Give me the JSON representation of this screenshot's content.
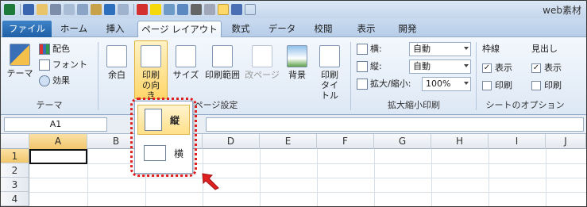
{
  "title_bar": {
    "title": "web素材"
  },
  "tabs": [
    "ファイル",
    "ホーム",
    "挿入",
    "ページ レイアウト",
    "数式",
    "データ",
    "校閲",
    "表示",
    "開発"
  ],
  "ribbon": {
    "theme": {
      "theme_label": "テーマ",
      "colors": "配色",
      "fonts": "フォント",
      "effects": "効果",
      "group": "テーマ"
    },
    "page_setup": {
      "margins": "余白",
      "orientation": "印刷の向き",
      "size": "サイズ",
      "print_area": "印刷範囲",
      "breaks": "改ページ",
      "background": "背景",
      "print_titles": "印刷タイトル",
      "group": "ページ設定"
    },
    "scale": {
      "width_label": "横:",
      "width_value": "自動",
      "height_label": "縦:",
      "height_value": "自動",
      "scale_label": "拡大/縮小:",
      "scale_value": "100%",
      "group": "拡大縮小印刷"
    },
    "sheet_options": {
      "gridlines": "枠線",
      "headings": "見出し",
      "view": "表示",
      "print": "印刷",
      "group": "シートのオプション"
    }
  },
  "formula_bar": {
    "name_box": "A1"
  },
  "columns": [
    "A",
    "B",
    "C",
    "D",
    "E",
    "F",
    "G",
    "H",
    "I",
    "J"
  ],
  "rows": [
    "1",
    "2",
    "3",
    "4"
  ],
  "orientation_menu": {
    "portrait": "縦",
    "landscape": "横"
  },
  "colors": {
    "accent": "#1f5fa6",
    "highlight": "#e02020",
    "selected_header": "#f2c66b"
  }
}
